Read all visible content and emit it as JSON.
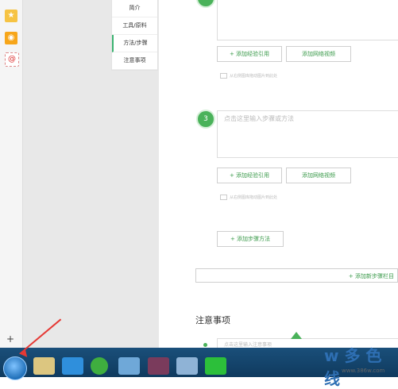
{
  "toc": {
    "items": [
      "简介",
      "工具/原料",
      "方法/步骤",
      "注意事项"
    ],
    "active_index": 2
  },
  "steps": {
    "add_experience_label": "+ 添加经验引用",
    "add_video_label": "添加网络视频",
    "image_hint": "从右侧图库拖动图片到此处",
    "step3_number": "3",
    "step3_placeholder": "点击这里输入步骤或方法",
    "add_step_method_label": "+ 添加步骤方法",
    "add_new_step_section_label": "+ 添加新步骤栏目"
  },
  "notes": {
    "title": "注意事项",
    "input_placeholder": "点击这里输入注意事项"
  },
  "sidebar": {
    "add_label": "+"
  },
  "watermark": {
    "brand": "w 多 色 线",
    "url": "www.386w.com"
  },
  "colors": {
    "accent_green": "#3a9a4a",
    "taskbar": "#1a4f7a",
    "arrow": "#e53935"
  }
}
